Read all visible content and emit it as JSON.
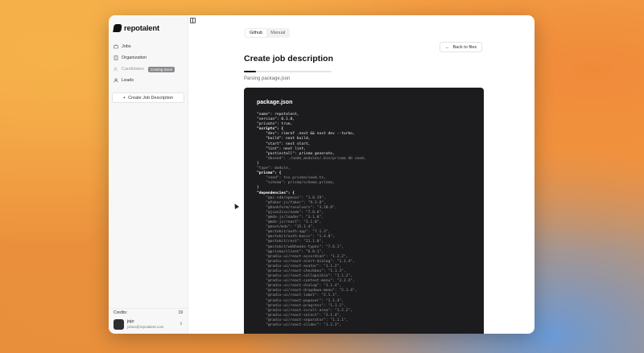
{
  "app": {
    "logo_text": "repotalent"
  },
  "sidebar": {
    "items": [
      {
        "label": "Jobs",
        "icon": "briefcase-icon"
      },
      {
        "label": "Organization",
        "icon": "building-icon"
      },
      {
        "label": "Candidates",
        "icon": "users-icon",
        "badge": "Coming Soon",
        "disabled": true
      },
      {
        "label": "Leads",
        "icon": "user-icon"
      }
    ],
    "create_button": "Create Job Description",
    "credits_label": "Credits:",
    "credits_value": "19",
    "user": {
      "name": "jojo",
      "email": "johan@repotalent.com"
    }
  },
  "main": {
    "tabs": [
      {
        "label": "Github",
        "active": true
      },
      {
        "label": "Manual",
        "active": false
      }
    ],
    "back_button": "Back to files",
    "title": "Create job description",
    "progress_fraction": 0.14,
    "status": "Parsing package.json"
  },
  "code": {
    "file_name": "package.json",
    "lines": [
      {
        "text": "\"name\": repotalent,",
        "style": "normal"
      },
      {
        "text": "\"version\": 0.1.0,",
        "style": "normal"
      },
      {
        "text": "\"private\": true,",
        "style": "normal"
      },
      {
        "text": "\"scripts\": {",
        "style": "bold"
      },
      {
        "text": "    \"dev\": rimraf .next && next dev --turbo,",
        "style": "normal"
      },
      {
        "text": "    \"build\": next build,",
        "style": "normal"
      },
      {
        "text": "    \"start\": next start,",
        "style": "normal"
      },
      {
        "text": "    \"lint\": next lint,",
        "style": "normal"
      },
      {
        "text": "    \"postinstall\": prisma generate,",
        "style": "normal"
      },
      {
        "text": "    \"dbseed\": ./node_modules/.bin/prisma db seed,",
        "style": "dim"
      },
      {
        "text": "}",
        "style": "normal"
      },
      {
        "text": "\"type\": module,",
        "style": "dim"
      },
      {
        "text": "\"prisma\": {",
        "style": "bold"
      },
      {
        "text": "    \"seed\": tsx prisma/seed.ts,",
        "style": "dim"
      },
      {
        "text": "    \"schema\": prisma/schema.prisma,",
        "style": "dim"
      },
      {
        "text": "}",
        "style": "normal"
      },
      {
        "text": "\"dependencies\": {",
        "style": "bold"
      },
      {
        "text": "    \"@ai-sdk/openai\": \"1.0.19\",",
        "style": "dim"
      },
      {
        "text": "    \"@faker-js/faker\": \"9.3.0\",",
        "style": "dim"
      },
      {
        "text": "    \"@hookform/resolvers\": \"3.10.0\",",
        "style": "dim"
      },
      {
        "text": "    \"@json2csv/node\": \"7.0.6\",",
        "style": "dim"
      },
      {
        "text": "    \"@mdx-js/loader\": \"3.1.0\",",
        "style": "dim"
      },
      {
        "text": "    \"@mdx-js/react\": \"3.1.0\",",
        "style": "dim"
      },
      {
        "text": "    \"@next/mdx\": \"15.1.4\",",
        "style": "dim"
      },
      {
        "text": "    \"@octokit/auth-app\": \"7.1.3\",",
        "style": "dim"
      },
      {
        "text": "    \"@octokit/auth-basic\": \"1.4.8\",",
        "style": "dim"
      },
      {
        "text": "    \"@octokit/rest\": \"21.1.0\",",
        "style": "dim"
      },
      {
        "text": "    \"@octokit/webhooks-types\": \"7.6.1\",",
        "style": "dim"
      },
      {
        "text": "    \"@prisma/client\": \"6.0.1\",",
        "style": "dim"
      },
      {
        "text": "    \"@radix-ui/react-accordion\": \"1.2.2\",",
        "style": "dim"
      },
      {
        "text": "    \"@radix-ui/react-alert-dialog\": \"1.1.4\",",
        "style": "dim"
      },
      {
        "text": "    \"@radix-ui/react-avatar\": \"1.1.2\",",
        "style": "dim"
      },
      {
        "text": "    \"@radix-ui/react-checkbox\": \"1.1.3\",",
        "style": "dim"
      },
      {
        "text": "    \"@radix-ui/react-collapsible\": \"1.1.2\",",
        "style": "dim"
      },
      {
        "text": "    \"@radix-ui/react-context-menu\": \"2.2.4\",",
        "style": "dim"
      },
      {
        "text": "    \"@radix-ui/react-dialog\": \"1.1.4\",",
        "style": "dim"
      },
      {
        "text": "    \"@radix-ui/react-dropdown-menu\": \"2.1.4\",",
        "style": "dim"
      },
      {
        "text": "    \"@radix-ui/react-label\": \"2.1.1\",",
        "style": "dim"
      },
      {
        "text": "    \"@radix-ui/react-popover\": \"1.1.4\",",
        "style": "dim"
      },
      {
        "text": "    \"@radix-ui/react-progress\": \"1.1.1\",",
        "style": "dim"
      },
      {
        "text": "    \"@radix-ui/react-scroll-area\": \"1.2.2\",",
        "style": "dim"
      },
      {
        "text": "    \"@radix-ui/react-select\": \"2.1.4\",",
        "style": "dim"
      },
      {
        "text": "    \"@radix-ui/react-separator\": \"1.1.1\",",
        "style": "dim"
      },
      {
        "text": "    \"@radix-ui/react-slider\": \"1.2.2\",",
        "style": "dim"
      }
    ]
  }
}
